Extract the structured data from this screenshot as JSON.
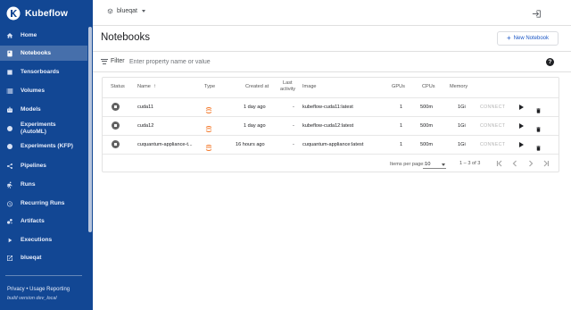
{
  "app": {
    "brand": "Kubeflow"
  },
  "sidebar": {
    "items": [
      {
        "label": "Home",
        "icon": "home-icon"
      },
      {
        "label": "Notebooks",
        "icon": "notebook-icon",
        "active": true
      },
      {
        "label": "Tensorboards",
        "icon": "tensorboard-icon"
      },
      {
        "label": "Volumes",
        "icon": "storage-icon"
      },
      {
        "label": "Models",
        "icon": "robot-icon"
      },
      {
        "label": "Experiments (AutoML)",
        "icon": "tune-icon"
      },
      {
        "label": "Experiments (KFP)",
        "icon": "flask-icon"
      },
      {
        "label": "Pipelines",
        "icon": "share-icon"
      },
      {
        "label": "Runs",
        "icon": "directions-run-icon"
      },
      {
        "label": "Recurring Runs",
        "icon": "alarm-icon"
      },
      {
        "label": "Artifacts",
        "icon": "bubble-icon"
      },
      {
        "label": "Executions",
        "icon": "play-arrow-icon"
      },
      {
        "label": "blueqat",
        "icon": "open-in-new-icon"
      }
    ],
    "footer_privacy": "Privacy",
    "footer_sep": " • ",
    "footer_usage": "Usage Reporting",
    "build_version": "build version dev_local"
  },
  "topbar": {
    "namespace": "blueqat"
  },
  "page": {
    "title": "Notebooks",
    "new_button": "New Notebook"
  },
  "filter": {
    "label": "Filter",
    "placeholder": "Enter property name or value"
  },
  "table": {
    "headers": {
      "status": "Status",
      "name": "Name",
      "type": "Type",
      "created": "Created at",
      "last_activity_1": "Last",
      "last_activity_2": "activity",
      "image": "Image",
      "gpus": "GPUs",
      "cpus": "CPUs",
      "memory": "Memory"
    },
    "rows": [
      {
        "name": "cuda11",
        "created": "1 day ago",
        "last": "-",
        "image": "kubeflow-cuda11:latest",
        "gpus": "1",
        "cpus": "500m",
        "memory": "1Gi",
        "connect": "CONNECT"
      },
      {
        "name": "cuda12",
        "created": "1 day ago",
        "last": "-",
        "image": "kubeflow-cuda12:latest",
        "gpus": "1",
        "cpus": "500m",
        "memory": "1Gi",
        "connect": "CONNECT"
      },
      {
        "name": "cuquantum-appliance-t...",
        "created": "16 hours ago",
        "last": "-",
        "image": "cuquantum-appliance:latest",
        "gpus": "1",
        "cpus": "500m",
        "memory": "1Gi",
        "connect": "CONNECT"
      }
    ]
  },
  "paginator": {
    "items_per_page_label": "Items per page:",
    "page_size": "10",
    "range": "1 – 3 of 3"
  },
  "colors": {
    "sidebar": "#124794",
    "accent": "#1a56c6",
    "type_icon": "#f37626"
  }
}
